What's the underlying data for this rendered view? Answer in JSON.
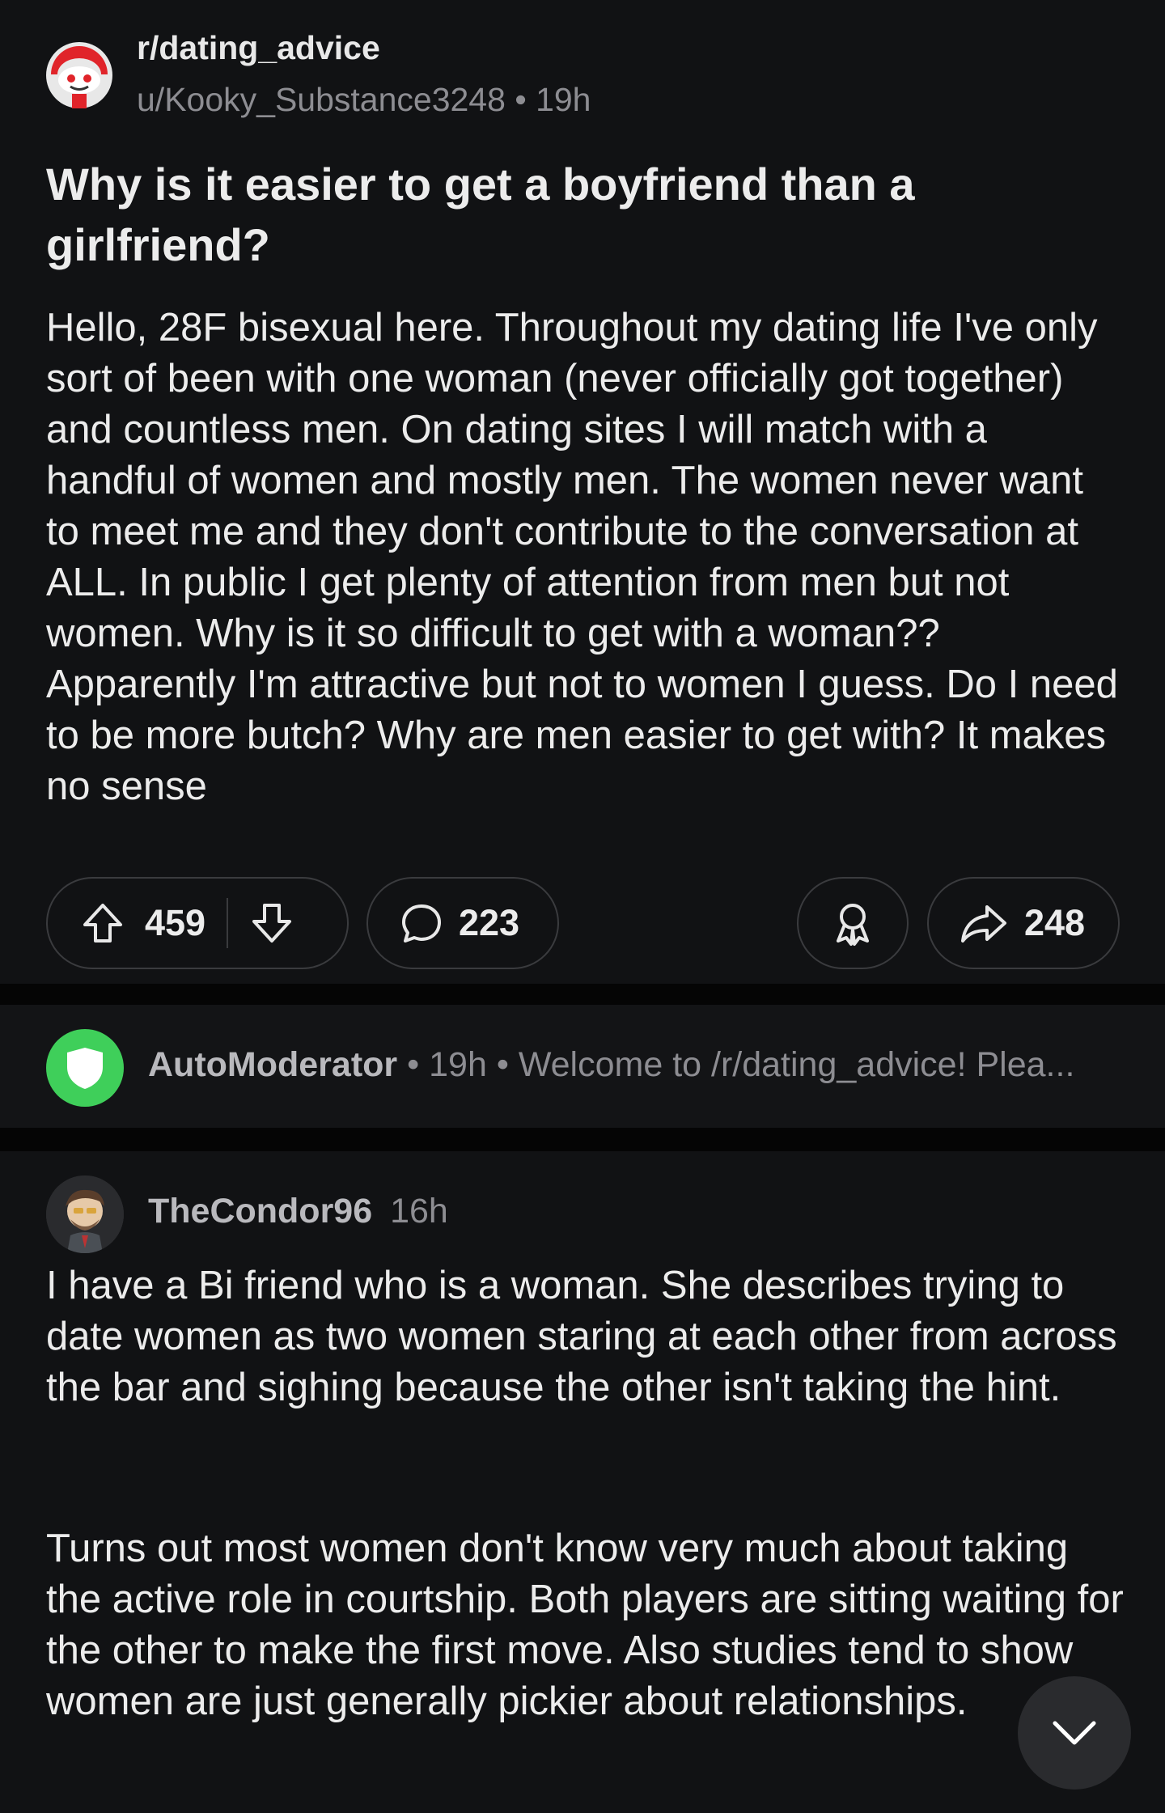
{
  "post": {
    "subreddit": "r/dating_advice",
    "author": "u/Kooky_Substance3248",
    "age": "19h",
    "title": "Why is it easier to get a boyfriend than a girlfriend?",
    "body": "Hello, 28F bisexual here. Throughout my dating life I've only sort of been with one woman (never officially got together) and countless men. On dating sites I will match with a handful of women and mostly men. The women never want to meet me and they don't contribute to the conversation at ALL. In public I get plenty of attention from men but not women. Why is it so difficult to get with a woman?? Apparently I'm attractive but not to women I guess. Do I need to be more butch? Why are men easier to get with? It makes no sense",
    "upvotes": "459",
    "comments": "223",
    "shares": "248",
    "icons": [
      "subreddit-avatar-icon",
      "upvote-icon",
      "downvote-icon",
      "comment-icon",
      "award-icon",
      "share-icon"
    ]
  },
  "automod": {
    "name": "AutoModerator",
    "age": "19h",
    "preview": "Welcome to /r/dating_advice! Plea...",
    "icon": "shield-icon",
    "accent": "#3fcf5a"
  },
  "comment": {
    "author": "TheCondor96",
    "age": "16h",
    "paragraph1": "I have a Bi friend who is a woman. She describes trying to date women as two women staring at each other from across the bar and sighing because the other isn't taking the hint.",
    "paragraph2": "Turns out most women don't know very much about taking the active role in courtship. Both players are sitting waiting for the other to make the first move. Also studies tend to show women are just generally pickier about relationships."
  },
  "fab": {
    "icon": "chevron-down-icon"
  }
}
